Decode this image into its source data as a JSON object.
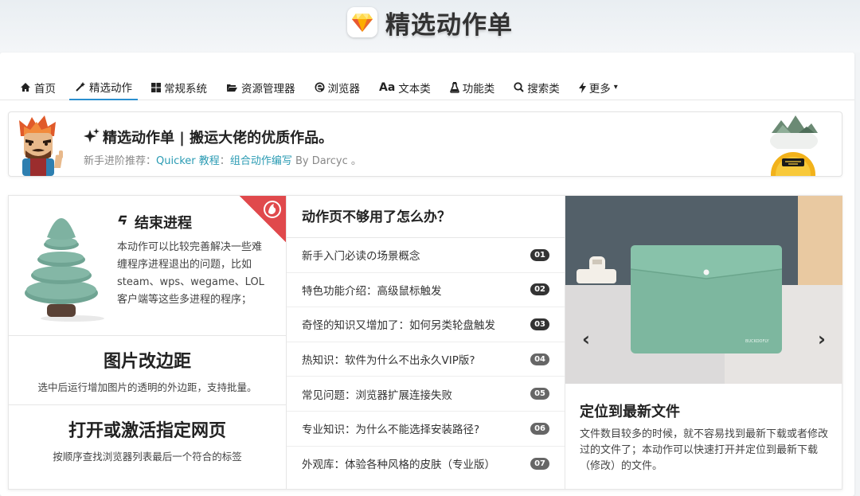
{
  "site": {
    "title": "精选动作单",
    "logo_icon": "sketch-diamond-icon"
  },
  "nav": {
    "items": [
      {
        "label": "首页",
        "icon": "home-icon"
      },
      {
        "label": "精选动作",
        "icon": "magic-wand-icon",
        "active": true
      },
      {
        "label": "常规系统",
        "icon": "windows-icon"
      },
      {
        "label": "资源管理器",
        "icon": "folder-open-icon"
      },
      {
        "label": "浏览器",
        "icon": "edge-icon"
      },
      {
        "label": "文本类",
        "icon": "text-aa-icon"
      },
      {
        "label": "功能类",
        "icon": "flask-icon"
      },
      {
        "label": "搜索类",
        "icon": "search-icon"
      },
      {
        "label": "更多",
        "icon": "bolt-icon",
        "dropdown": true
      }
    ],
    "active_color": "#2a8fcf"
  },
  "banner": {
    "title": "精选动作单 | 搬运大佬的优质作品。",
    "sub_prefix": "新手进阶推荐：",
    "link1": "Quicker 教程",
    "colon": "：",
    "link2": "组合动作编写",
    "sub_suffix": " By Darcyc 。",
    "link_color": "#2a9bb3"
  },
  "cards": {
    "end_process": {
      "title": "结束进程",
      "desc": "本动作可以比较完善解决一些难缠程序进程退出的问题，比如steam、wps、wegame、LOL客户端等这些多进程的程序；"
    },
    "image_padding": {
      "title": "图片改边距",
      "desc": "选中后运行增加图片的透明的外边距，支持批量。"
    },
    "open_webpage": {
      "title": "打开或激活指定网页",
      "desc": "按顺序查找浏览器列表最后一个符合的标签"
    },
    "faq": {
      "title": "动作页不够用了怎么办？",
      "items": [
        {
          "label": "新手入门必读の场景概念",
          "num": "01"
        },
        {
          "label": "特色功能介绍：高级鼠标触发",
          "num": "02"
        },
        {
          "label": "奇怪的知识又增加了：如何另类轮盘触发",
          "num": "03"
        },
        {
          "label": "热知识：软件为什么不出永久VIP版?",
          "num": "04"
        },
        {
          "label": "常见问题：浏览器扩展连接失败",
          "num": "05"
        },
        {
          "label": "专业知识：为什么不能选择安装路径?",
          "num": "06"
        },
        {
          "label": "外观库：体验各种风格的皮肤（专业版）",
          "num": "07"
        }
      ]
    },
    "slide": {
      "title": "定位到最新文件",
      "desc": "文件数目较多的时候，就不容易找到最新下载或者修改过的文件了；本动作可以快速打开并定位到最新下载（修改）的文件。",
      "brand_text": "BUCKOOFLY",
      "prev_icon": "chevron-left-icon",
      "next_icon": "chevron-right-icon"
    }
  },
  "colors": {
    "ribbon": "#e0494c",
    "envelope": "#7fb9a1",
    "tree": "#7db1a0"
  }
}
